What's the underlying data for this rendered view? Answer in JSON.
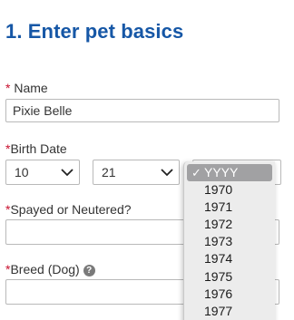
{
  "heading": "1. Enter pet basics",
  "name_field": {
    "required_mark": "*",
    "label": "Name",
    "value": "Pixie Belle"
  },
  "birth_date": {
    "required_mark": "*",
    "label": "Birth Date",
    "month_value": "10",
    "day_value": "21",
    "year_dropdown": {
      "selected": "YYYY",
      "check_mark": "✓",
      "options": [
        "1970",
        "1971",
        "1972",
        "1973",
        "1974",
        "1975",
        "1976",
        "1977"
      ]
    }
  },
  "spayed": {
    "required_mark": "*",
    "label": "Spayed or Neutered?",
    "value": ""
  },
  "breed": {
    "required_mark": "*",
    "label": "Breed (Dog)",
    "help_icon_glyph": "?",
    "value": ""
  },
  "colors": {
    "heading": "#1657a6",
    "required": "#c8102e",
    "dropdown_highlight": "#a1a1a3"
  },
  "icons": [
    "chevron-down-icon",
    "help-icon",
    "checkmark-icon"
  ]
}
